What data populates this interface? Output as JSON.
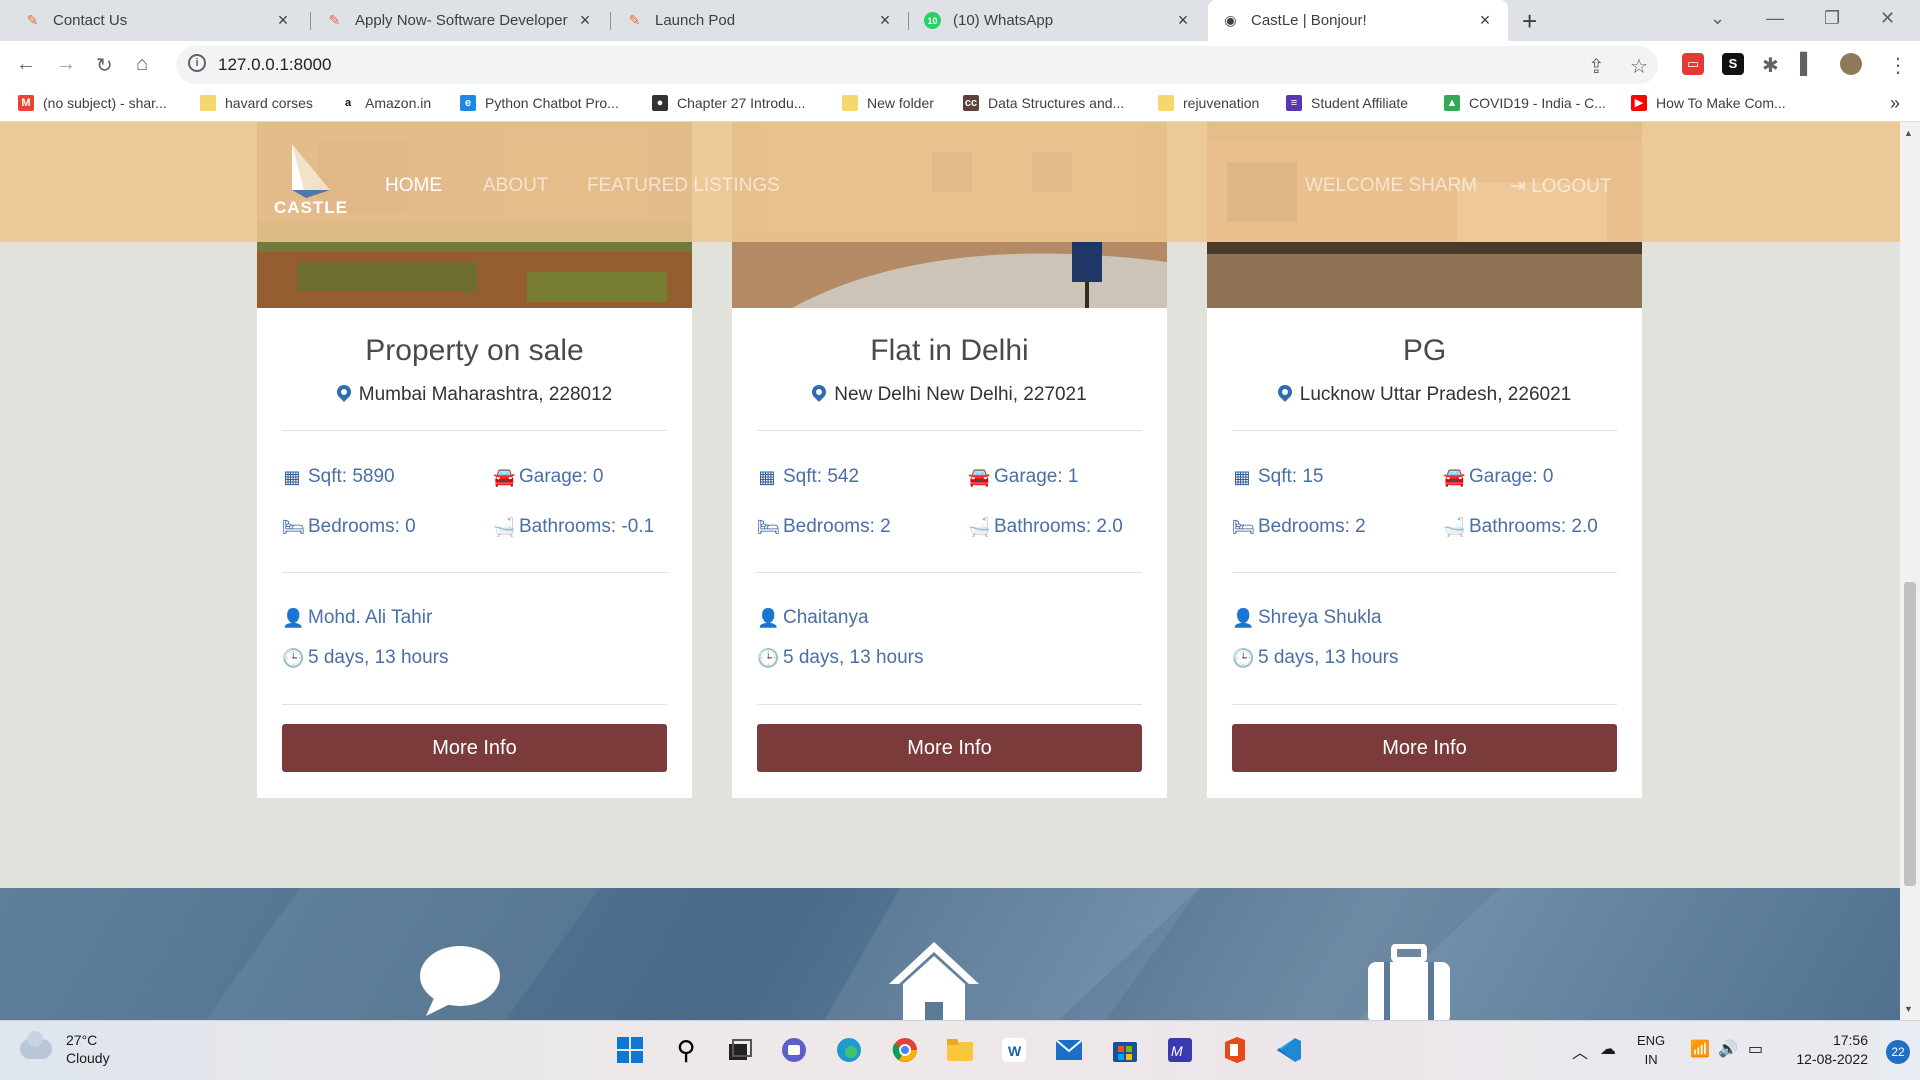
{
  "browser": {
    "tabs": [
      {
        "title": "Contact Us",
        "favicon": "postman-icon",
        "active": false
      },
      {
        "title": "Apply Now- Software Developer",
        "favicon": "postman-icon",
        "active": false
      },
      {
        "title": "Launch Pod",
        "favicon": "postman-icon",
        "active": false
      },
      {
        "title": "(10) WhatsApp",
        "favicon": "whatsapp-icon",
        "badge": "10",
        "active": false
      },
      {
        "title": "CastLe | Bonjour!",
        "favicon": "globe-icon",
        "active": true
      }
    ],
    "url": "127.0.0.1:8000",
    "bookmarks": [
      {
        "label": "(no subject) - shar...",
        "icon": "gmail-icon",
        "color": "#ea4335",
        "glyph": "M"
      },
      {
        "label": "havard corses",
        "icon": "folder-icon",
        "color": "#f5c518",
        "glyph": ""
      },
      {
        "label": "Amazon.in",
        "icon": "amazon-icon",
        "color": "#ffffff",
        "glyph": "a"
      },
      {
        "label": "Python Chatbot Pro...",
        "icon": "edge-icon",
        "color": "#1e88e5",
        "glyph": "e"
      },
      {
        "label": "Chapter 27 Introdu...",
        "icon": "globe-icon",
        "color": "#333333",
        "glyph": "●"
      },
      {
        "label": "New folder",
        "icon": "folder-icon",
        "color": "#f5c518",
        "glyph": ""
      },
      {
        "label": "Data Structures and...",
        "icon": "cc-icon",
        "color": "#5d4037",
        "glyph": "cc"
      },
      {
        "label": "rejuvenation",
        "icon": "folder-icon",
        "color": "#f5c518",
        "glyph": ""
      },
      {
        "label": "Student Affiliate",
        "icon": "affiliate-icon",
        "color": "#5c35b5",
        "glyph": "≡"
      },
      {
        "label": "COVID19 - India - C...",
        "icon": "drive-icon",
        "color": "#34a853",
        "glyph": "▲"
      },
      {
        "label": "How To Make Com...",
        "icon": "youtube-icon",
        "color": "#ff0000",
        "glyph": "▶"
      }
    ]
  },
  "site": {
    "logo_text": "CASTLE",
    "nav": [
      {
        "label": "HOME",
        "active": true
      },
      {
        "label": "ABOUT",
        "active": false
      },
      {
        "label": "FEATURED LISTINGS",
        "active": false
      }
    ],
    "welcome": "WELCOME SHARM",
    "logout": "LOGOUT"
  },
  "listings": [
    {
      "title": "Property on sale",
      "location": "Mumbai Maharashtra, 228012",
      "sqft": "Sqft: 5890",
      "garage": "Garage: 0",
      "bedrooms": "Bedrooms: 0",
      "bathrooms": "Bathrooms: -0.1",
      "realtor": "Mohd. Ali Tahir",
      "listed": "5 days, 13 hours",
      "button": "More Info"
    },
    {
      "title": "Flat in Delhi",
      "location": "New Delhi New Delhi, 227021",
      "sqft": "Sqft: 542",
      "garage": "Garage: 1",
      "bedrooms": "Bedrooms: 2",
      "bathrooms": "Bathrooms: 2.0",
      "realtor": "Chaitanya",
      "listed": "5 days, 13 hours",
      "button": "More Info"
    },
    {
      "title": "PG",
      "location": "Lucknow Uttar Pradesh, 226021",
      "sqft": "Sqft: 15",
      "garage": "Garage: 0",
      "bedrooms": "Bedrooms: 2",
      "bathrooms": "Bathrooms: 2.0",
      "realtor": "Shreya Shukla",
      "listed": "5 days, 13 hours",
      "button": "More Info"
    }
  ],
  "taskbar": {
    "weather_temp": "27°C",
    "weather_desc": "Cloudy",
    "lang_top": "ENG",
    "lang_bottom": "IN",
    "time": "17:56",
    "date": "12-08-2022",
    "notifications": "22"
  },
  "colors": {
    "accent_button": "#7b3b3b",
    "navbar": "#eec48e",
    "icon_blue": "#2e5d98"
  }
}
